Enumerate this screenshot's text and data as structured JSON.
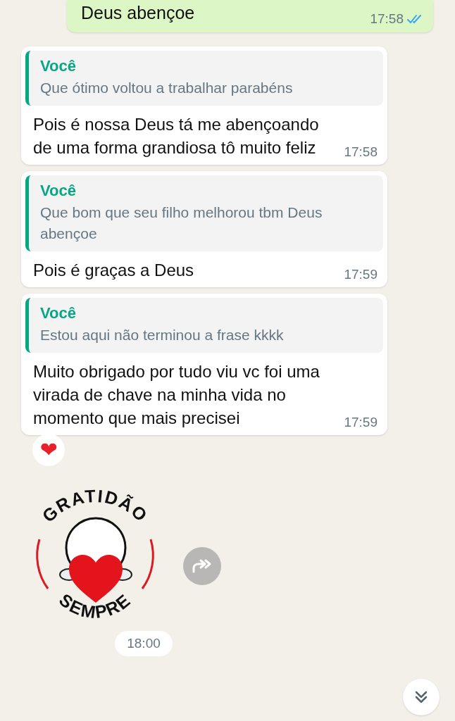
{
  "outgoing_top": {
    "text": "Deus abençoe",
    "time": "17:58",
    "read": true
  },
  "messages": [
    {
      "quote": {
        "author": "Você",
        "text": "Que ótimo voltou a trabalhar parabéns"
      },
      "text": "Pois é nossa Deus tá me abençoando de uma forma grandiosa tô muito feliz",
      "time": "17:58"
    },
    {
      "quote": {
        "author": "Você",
        "text": "Que bom que seu filho melhorou tbm Deus abençoe"
      },
      "text": "Pois é graças a Deus",
      "time": "17:59"
    },
    {
      "quote": {
        "author": "Você",
        "text": "Estou aqui não terminou a frase kkkk"
      },
      "text": "Muito obrigado por tudo viu vc foi uma virada de chave na minha vida no momento que mais precisei",
      "time": "17:59",
      "reaction": "❤"
    }
  ],
  "sticker": {
    "top_text": "GRATIDÃO",
    "bottom_text": "SEMPRE",
    "time": "18:00"
  }
}
